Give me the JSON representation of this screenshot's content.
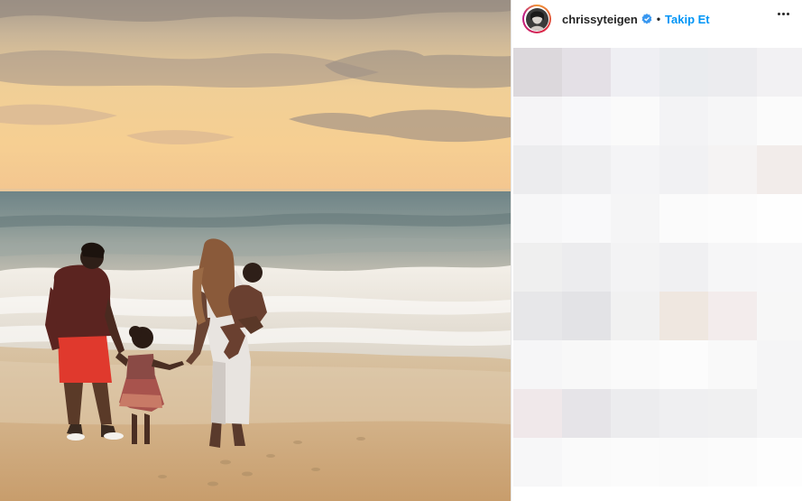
{
  "post": {
    "username": "chrissyteigen",
    "verified": true,
    "separator": "•",
    "follow_label": "Takip Et",
    "more_icon": "more-horizontal-icon",
    "avatar_icon": "profile-avatar",
    "photo_description_icon": "beach-family-photo",
    "caption_area": "pixelated-blurred-content"
  },
  "colors": {
    "follow": "#0095f6",
    "text": "#262626",
    "verified_badge": "#3897f0",
    "divider": "#e6e6e6"
  },
  "pixel_tiles": [
    [
      "#dcd8dc",
      "#e4e0e6",
      "#efeff3",
      "#eaecef",
      "#ececef",
      "#f2f1f3",
      "#f5f5f7",
      "#fbfbfb"
    ],
    [
      "#f5f4f6",
      "#f8f8fa",
      "#fafafa",
      "#f3f3f5",
      "#f6f6f7",
      "#fbfbfb",
      "#fcfcfc",
      "#ffffff"
    ],
    [
      "#ececee",
      "#efeff1",
      "#f4f4f6",
      "#f1f1f3",
      "#f5f3f3",
      "#f2ecea",
      "#f9f9f9",
      "#ffffff"
    ],
    [
      "#f7f7f8",
      "#f9f9fa",
      "#f5f5f6",
      "#fbfbfb",
      "#fcfcfc",
      "#fefefe",
      "#ffffff",
      "#ffffff"
    ],
    [
      "#efefef",
      "#ececee",
      "#f3f3f4",
      "#f0f0f2",
      "#f6f6f7",
      "#f7f7f8",
      "#fafafa",
      "#ffffff"
    ],
    [
      "#e7e7e9",
      "#e3e3e6",
      "#f1f1f1",
      "#efe7e0",
      "#f3ecec",
      "#f7f7f7",
      "#fafafa",
      "#ffffff"
    ],
    [
      "#f6f6f7",
      "#f8f8f8",
      "#fafafa",
      "#fcfcfc",
      "#f9f9f9",
      "#f5f5f6",
      "#fbfbfb",
      "#ffffff"
    ],
    [
      "#f0e8ea",
      "#e6e4e8",
      "#ececee",
      "#efeff1",
      "#f0f0f1",
      "#f5f5f6",
      "#f7f7f7",
      "#ffffff"
    ],
    [
      "#f7f7f8",
      "#fafafa",
      "#fbfbfb",
      "#fafafa",
      "#fbfbfb",
      "#fdfdfd",
      "#ffffff",
      "#ffffff"
    ]
  ]
}
